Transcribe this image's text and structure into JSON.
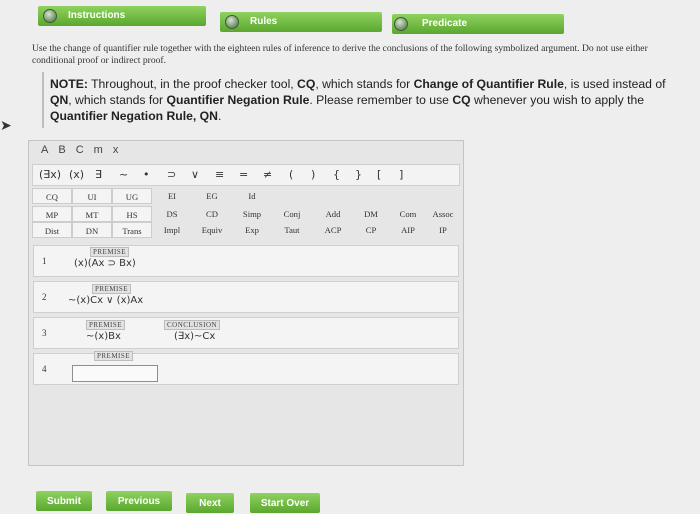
{
  "tabs": [
    {
      "label": "Instructions"
    },
    {
      "label": "Rules"
    },
    {
      "label": "Predicate"
    }
  ],
  "instructions": {
    "text": "Use the change of quantifier rule together with the eighteen rules of inference to derive the conclusions of the following symbolized argument. Do not use either conditional proof or indirect proof."
  },
  "note": {
    "lead": "NOTE:",
    "t1": " Throughout, in the proof checker tool, ",
    "cq": "CQ",
    "t2": ", which stands for ",
    "cqr": "Change of Quantifier Rule",
    "t3": ", is used instead of ",
    "qn": "QN",
    "t4": ", which stands for ",
    "qnr": "Quantifier Negation Rule",
    "t5": ". Please remember to use ",
    "cq2": "CQ",
    "t6": " whenever you wish to apply the ",
    "qnr2": "Quantifier Negation Rule, QN",
    "t7": "."
  },
  "arrow": "➤",
  "font_options": [
    "A",
    "B",
    "C",
    "m",
    "x"
  ],
  "symbols": [
    "(∃x)",
    "(x)",
    "∃",
    "~",
    "•",
    "⊃",
    "∨",
    "≡",
    "=",
    "≠",
    "(",
    ")",
    "{",
    "}",
    "[",
    "]"
  ],
  "rules": {
    "row1": [
      "CQ",
      "UI",
      "UG",
      "EI",
      "EG",
      "Id"
    ],
    "row2": [
      "MP",
      "MT",
      "HS",
      "DS",
      "CD",
      "Simp",
      "Conj",
      "Add",
      "DM",
      "Com",
      "Assoc"
    ],
    "row3": [
      "Dist",
      "DN",
      "Trans",
      "Impl",
      "Equiv",
      "Exp",
      "Taut",
      "ACP",
      "CP",
      "AIP",
      "IP"
    ]
  },
  "proof": {
    "lines": [
      {
        "num": "1",
        "tag": "PREMISE",
        "formula": "(x)(Ax ⊃ Bx)"
      },
      {
        "num": "2",
        "tag": "PREMISE",
        "formula": "~(x)Cx ∨ (x)Ax"
      },
      {
        "num": "3",
        "tag": "PREMISE",
        "formula": "~(x)Bx",
        "conclusion_tag": "CONCLUSION",
        "conclusion": "(∃x)~Cx"
      },
      {
        "num": "4",
        "tag": "PREMISE",
        "formula": ""
      }
    ]
  },
  "buttons": {
    "submit": "Submit",
    "previous": "Previous",
    "next": "Next",
    "start_over": "Start Over"
  }
}
